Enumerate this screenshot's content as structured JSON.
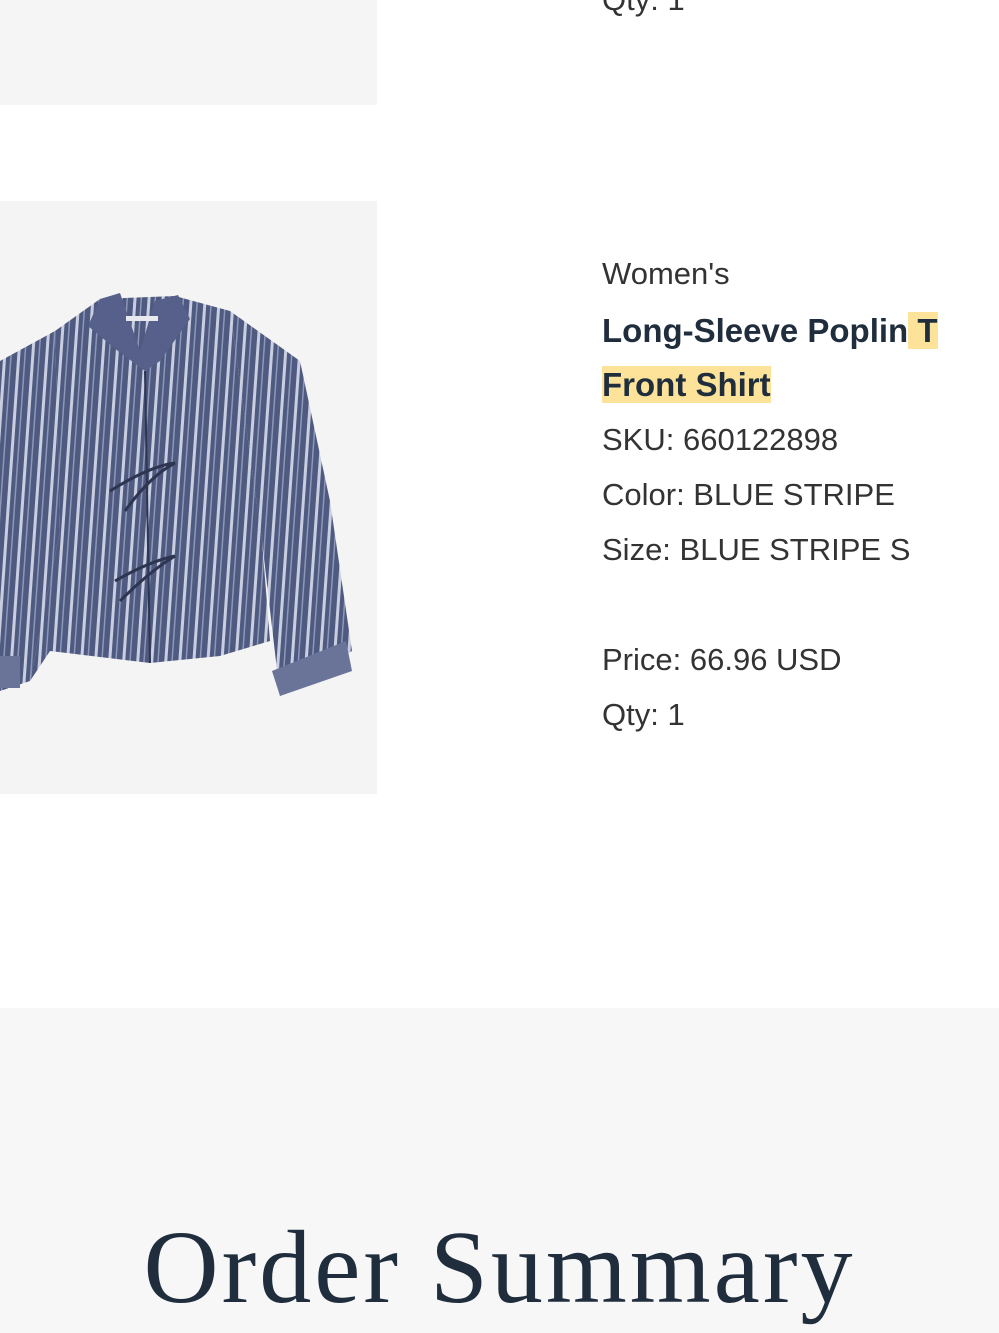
{
  "previous_item": {
    "qty": "Qty: 1"
  },
  "item": {
    "image_alt": "Women's Long-Sleeve Poplin Tie-Front Shirt in blue stripe",
    "gender": "Women's",
    "name_line1": "Long-Sleeve Poplin",
    "name_line1_cut": " T",
    "name_line2": "Front Shirt",
    "sku": "SKU: 660122898",
    "color": "Color: BLUE STRIPE",
    "size": "Size: BLUE STRIPE S",
    "price": "Price: 66.96 USD",
    "qty": "Qty: 1",
    "highlight_color": "#fde39a",
    "stripe_color": "#5a6388"
  },
  "summary": {
    "title": "Order Summary"
  }
}
